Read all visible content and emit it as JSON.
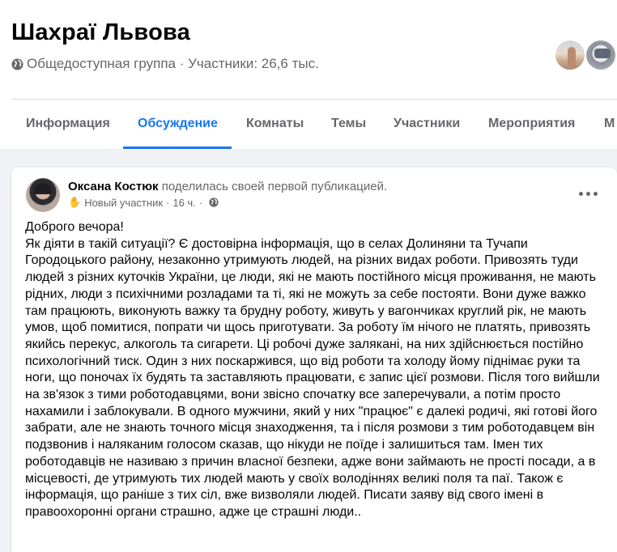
{
  "group": {
    "title": "Шахраї Львова",
    "meta": "Общедоступная группа · Участники: 26,6 тыс."
  },
  "tabs": [
    {
      "label": "Информация",
      "active": false
    },
    {
      "label": "Обсуждение",
      "active": true
    },
    {
      "label": "Комнаты",
      "active": false
    },
    {
      "label": "Темы",
      "active": false
    },
    {
      "label": "Участники",
      "active": false
    },
    {
      "label": "Мероприятия",
      "active": false
    },
    {
      "label": "М",
      "active": false
    }
  ],
  "post": {
    "author": "Оксана Костюк",
    "action": "поделилась своей первой публикацией.",
    "badge": "Новый участник",
    "time": "16 ч.",
    "greeting": "Доброго вечора!",
    "body": "Як діяти в такій ситуації? Є достовірна інформація, що в селах Долиняни та Тучапи Городоцького району, незаконно утримують людей, на різних видах роботи. Привозять туди людей з різних куточків України, це люди, які не мають постійного місця проживання, не мають рідних, люди з психічними розладами та ті, які не можуть за себе постояти. Вони дуже важко там працюють, виконують важку та брудну роботу, живуть у вагончиках круглий рік, не мають умов, щоб помитися, попрати чи щось приготувати. За роботу їм нічого не платять, привозять якийсь перекус, алкоголь та сигарети. Ці робочі дуже залякані, на них здійснюється постійно психологічний тиск. Один з них поскаржився, що від роботи та холоду йому піднімає руки та ноги, що поночах їх будять та заставляють працювати, є запис цієї розмови. Після того вийшли на зв'язок з тими роботодавцями, вони звісно спочатку все заперечували, а потім просто нахамили і заблокували. В одного мужчини, який у них \"працює\" є далекі родичі, які готові його забрати, але не знають точного місця знаходження, та і після розмови з тим роботодавцем він подзвонив і наляканим голосом сказав, що нікуди не поїде і залишиться там. Імен тих роботодавців не називаю з причин власної безпеки, адже вони займають не прості посади, а в місцевості, де утримують тих людей мають у своїх володіннях великі поля та паї. Також є інформація, що раніше з тих сіл, вже визволяли людей. Писати заяву від свого імені в правоохоронні органи страшно, адже це страшні люди.."
  },
  "colors": {
    "accent": "#1877f2",
    "secondary_text": "#65676b",
    "background": "#f0f2f5"
  }
}
